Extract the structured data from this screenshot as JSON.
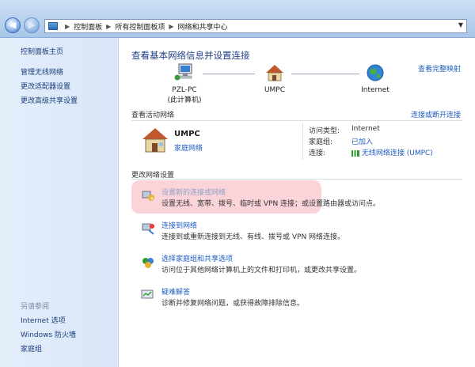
{
  "breadcrumb": {
    "items": [
      "控制面板",
      "所有控制面板项",
      "网络和共享中心"
    ]
  },
  "sidebar": {
    "items": [
      {
        "label": "控制面板主页"
      },
      {
        "label": "管理无线网络"
      },
      {
        "label": "更改适配器设置"
      },
      {
        "label": "更改高级共享设置"
      }
    ],
    "see_also_title": "另请参阅",
    "see_also": [
      {
        "label": "Internet 选项"
      },
      {
        "label": "Windows 防火墙"
      },
      {
        "label": "家庭组"
      }
    ]
  },
  "main": {
    "title": "查看基本网络信息并设置连接",
    "full_map_link": "查看完整映射",
    "nodes": [
      {
        "label": "PZL-PC",
        "sublabel": "(此计算机)"
      },
      {
        "label": "UMPC"
      },
      {
        "label": "Internet"
      }
    ],
    "active_header": "查看活动网络",
    "connect_link": "连接或断开连接",
    "active_network": {
      "name": "UMPC",
      "type": "家庭网络"
    },
    "details": [
      {
        "key": "访问类型:",
        "value": "Internet"
      },
      {
        "key": "家庭组:",
        "value": "已加入"
      },
      {
        "key": "连接:",
        "value": "无线网络连接 (UMPC)"
      }
    ],
    "change_header": "更改网络设置",
    "tasks": [
      {
        "link": "设置新的连接或网络",
        "desc": "设置无线、宽带、拨号、临时或 VPN 连接；或设置路由器或访问点。"
      },
      {
        "link": "连接到网络",
        "desc": "连接到或重新连接到无线、有线、拨号或 VPN 网络连接。"
      },
      {
        "link": "选择家庭组和共享选项",
        "desc": "访问位于其他网络计算机上的文件和打印机，或更改共享设置。"
      },
      {
        "link": "疑难解答",
        "desc": "诊断并修复网络问题，或获得故障排除信息。"
      }
    ]
  },
  "colors": {
    "link": "#1f5dbf",
    "title": "#1e3f86",
    "highlight": "#f6a0aa"
  }
}
